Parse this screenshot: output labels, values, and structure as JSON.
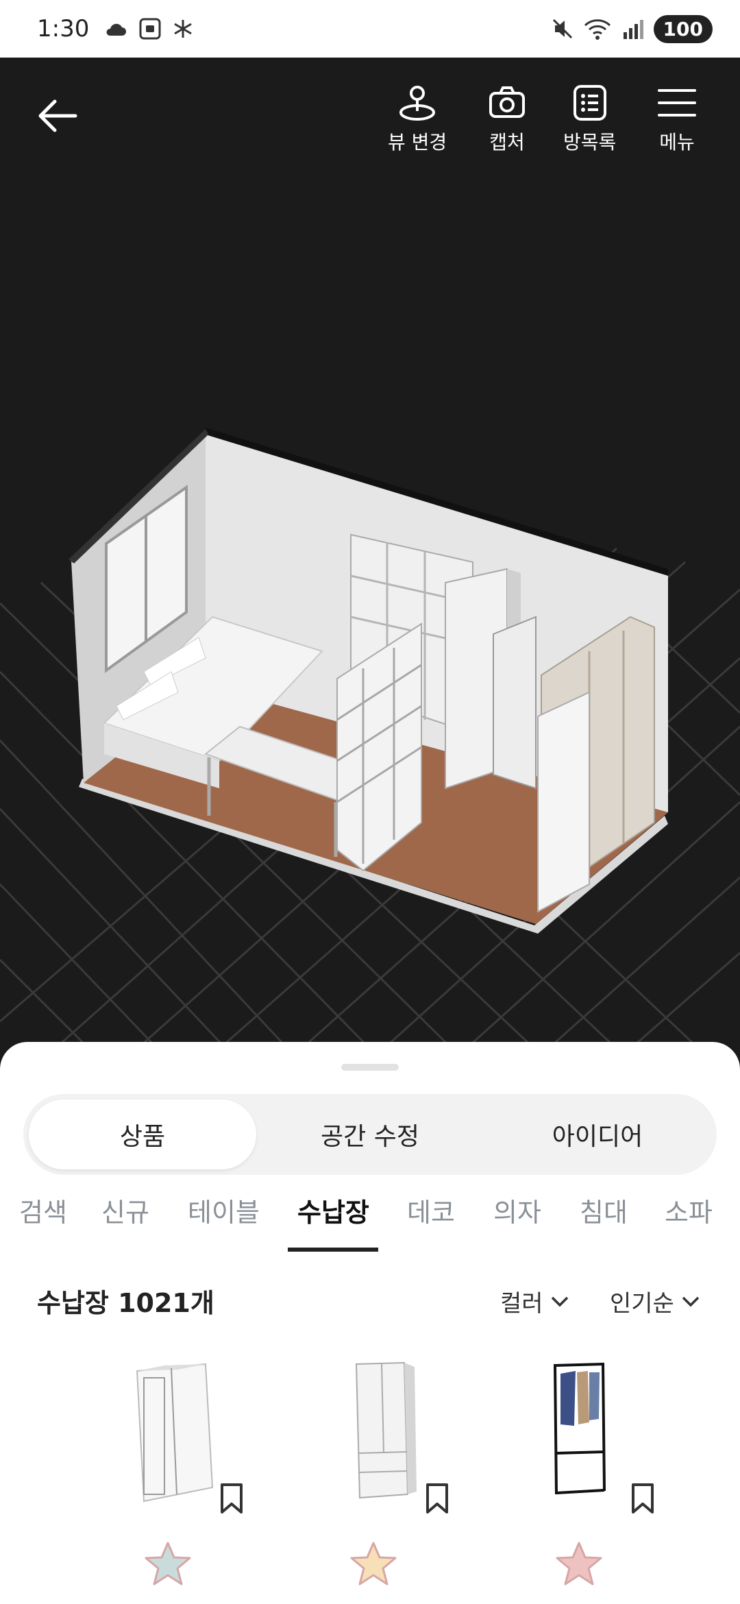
{
  "status_bar": {
    "time": "1:30",
    "battery": "100"
  },
  "toolbar": {
    "view_change": "뷰 변경",
    "capture": "캡처",
    "room_list": "방목록",
    "menu": "메뉴"
  },
  "segments": [
    "상품",
    "공간 수정",
    "아이디어"
  ],
  "categories": [
    "검색",
    "신규",
    "테이블",
    "수납장",
    "데코",
    "의자",
    "침대",
    "소파"
  ],
  "list": {
    "title": "수납장 1021개",
    "filter_color": "컬러",
    "filter_sort": "인기순"
  },
  "products": [
    {
      "name": "white-sliding-wardrobe",
      "star_color": "#c9dcdc"
    },
    {
      "name": "white-tall-wardrobe",
      "star_color": "#f7dfb8"
    },
    {
      "name": "black-clothes-rack",
      "star_color": "#efc2c2"
    }
  ],
  "colors": {
    "accent": "#222222",
    "floor": "#a0684a",
    "wall": "#ececec"
  }
}
